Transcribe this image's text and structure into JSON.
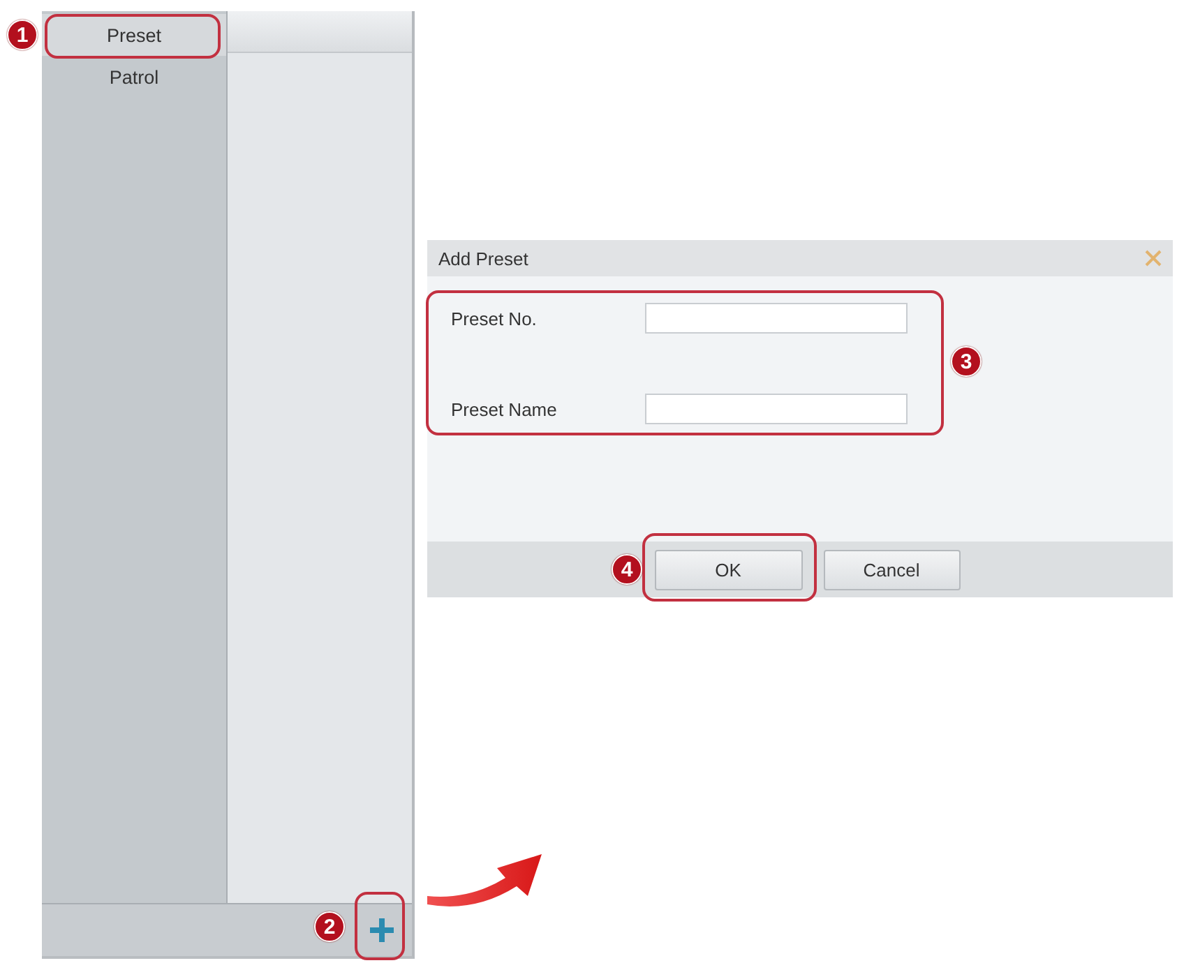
{
  "sidebar": {
    "tabs": [
      {
        "label": "Preset",
        "selected": true
      },
      {
        "label": "Patrol",
        "selected": false
      }
    ]
  },
  "dialog": {
    "title": "Add Preset",
    "fields": [
      {
        "label": "Preset No."
      },
      {
        "label": "Preset Name"
      }
    ],
    "buttons": [
      "OK",
      "Cancel"
    ]
  },
  "callouts": [
    {
      "number": "1"
    },
    {
      "number": "2"
    },
    {
      "number": "3"
    },
    {
      "number": "4"
    }
  ]
}
